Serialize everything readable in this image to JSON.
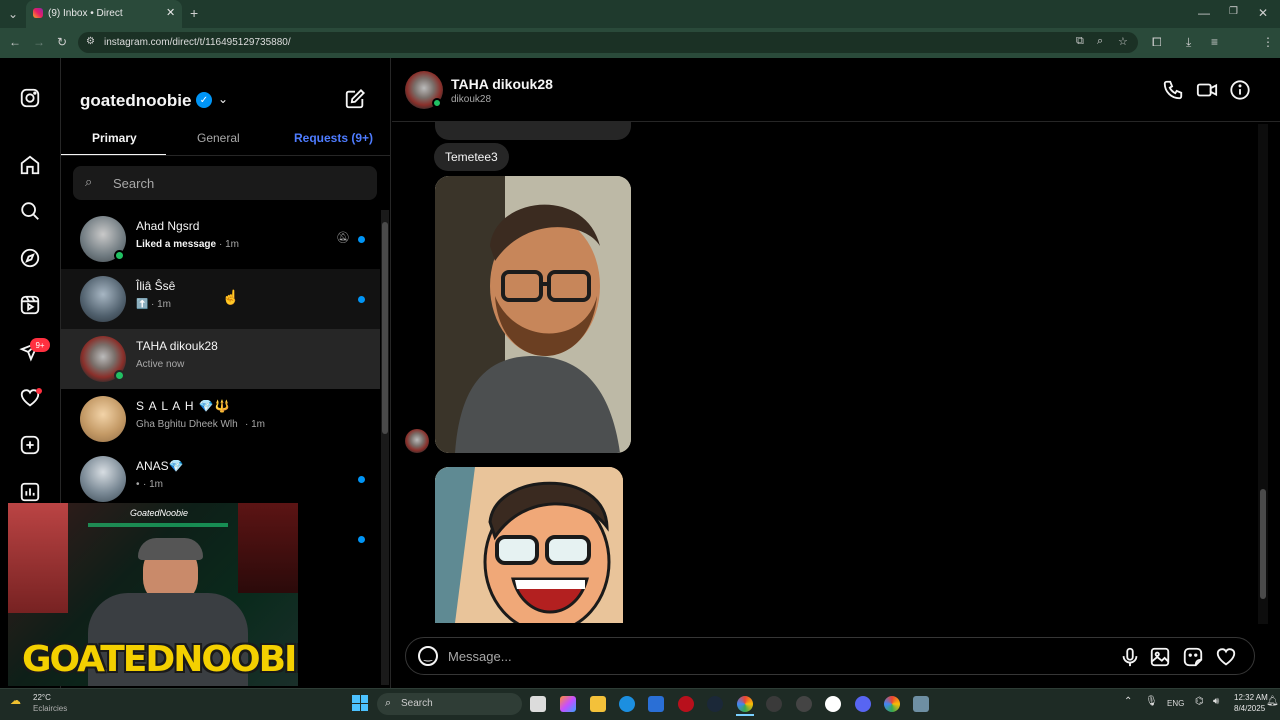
{
  "browser": {
    "tab_title": "(9) Inbox • Direct",
    "url": "instagram.com/direct/t/116495129735880/"
  },
  "sidebar": {
    "notification_badge": "9+",
    "items": [
      "instagram-logo-icon",
      "home-icon",
      "search-icon",
      "explore-icon",
      "reels-icon",
      "messages-icon",
      "notifications-icon",
      "create-icon",
      "dashboard-icon"
    ]
  },
  "inbox": {
    "username": "goatednoobie",
    "tabs": [
      {
        "label": "Primary"
      },
      {
        "label": "General"
      },
      {
        "label": "Requests (9+)"
      }
    ],
    "search_placeholder": "Search",
    "conversations": [
      {
        "name": "Ahad Ngsrd",
        "preview": "Liked a message",
        "time": " · 1m",
        "online": true,
        "muted": true,
        "unread": true
      },
      {
        "name": "Îliâ Ŝsê",
        "preview": "⬆️",
        "time": " · 1m",
        "online": false,
        "muted": false,
        "unread": true
      },
      {
        "name": "TAHA dikouk28",
        "preview": "Active now",
        "time": "",
        "online": true,
        "muted": false,
        "unread": false
      },
      {
        "name": "S A L A H 💎🔱",
        "preview": "Gha Bghitu Dheek Wlh",
        "time": " · 1m",
        "online": false,
        "muted": false,
        "unread": false
      },
      {
        "name": "ANAS💎",
        "preview": "•",
        "time": " · 1m",
        "online": false,
        "muted": false,
        "unread": true
      }
    ]
  },
  "chat": {
    "contact_name": "TAHA dikouk28",
    "contact_username": "dikouk28",
    "message_text": "Temetee3",
    "composer_placeholder": "Message..."
  },
  "overlay": {
    "streamer_tag": "GoatedNoobie",
    "banner_text": "GOATEDNOOBIE"
  },
  "taskbar": {
    "weather_temp": "22°C",
    "weather_desc": "Eclaircies",
    "search_label": "Search",
    "language": "ENG",
    "time": "12:32 AM",
    "date": "8/4/2025"
  },
  "colors": {
    "accent_blue": "#0095f6",
    "online_green": "#21c063",
    "badge_red": "#ff3040",
    "requests_blue": "#4e7cff"
  }
}
